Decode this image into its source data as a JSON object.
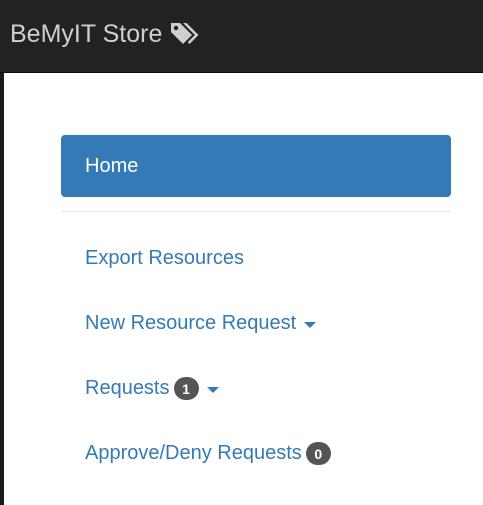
{
  "navbar": {
    "brand": "BeMyIT Store",
    "brand_icon": "tags-icon",
    "background": "#222222"
  },
  "sidebar": {
    "accent": "#337ab7",
    "home": "Home",
    "items": [
      {
        "label": "Export Resources"
      },
      {
        "label": "New Resource Request",
        "dropdown": true
      },
      {
        "label": "Requests",
        "badge": "1",
        "dropdown": true
      },
      {
        "label": "Approve/Deny Requests",
        "badge": "0"
      }
    ]
  }
}
